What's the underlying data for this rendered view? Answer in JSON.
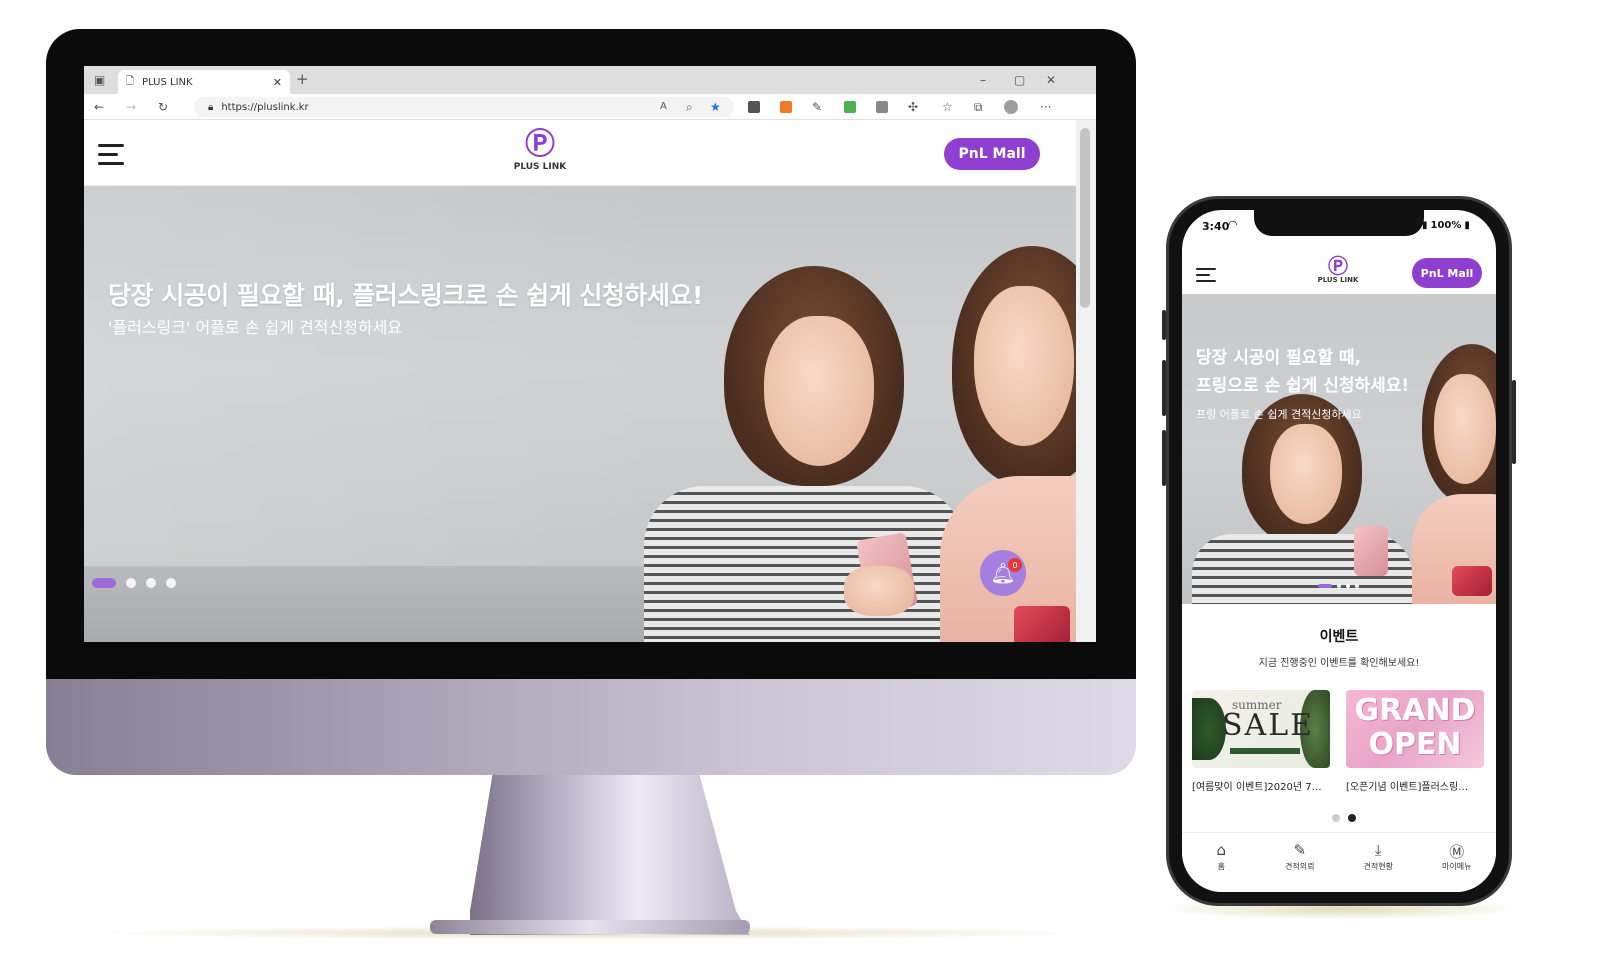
{
  "browser": {
    "tab_title": "PLUS LINK",
    "url": "https://pluslink.kr"
  },
  "site": {
    "logo_text": "PLUS LINK",
    "mall_button": "PnL Mall"
  },
  "desktop_hero": {
    "title": "당장 시공이 필요할 때, 플러스링크로 손 쉽게 신청하세요!",
    "subtitle": "'플러스링크' 어플로 손 쉽게 견적신청하세요",
    "notification_count": "0",
    "slide_count": 4,
    "active_slide": 1
  },
  "mobile": {
    "status_time": "3:40",
    "battery": "100%",
    "hero_title_line1": "당장 시공이 필요할 때,",
    "hero_title_line2": "프링으로 손 쉽게 신청하세요!",
    "hero_subtitle": "프링 어플로 손 쉽게 견적신청하세요",
    "events_title": "이벤트",
    "events_subtitle": "지금 진행중인 이벤트를 확인해보세요!",
    "events": [
      {
        "caption": "[여름맞이 이벤트]2020년 7…",
        "banner_small": "summer",
        "banner_big": "SALE"
      },
      {
        "caption": "[오픈기념 이벤트]플러스링…",
        "banner_big": "GRAND",
        "banner_big2": "OPEN"
      }
    ],
    "nav": [
      {
        "label": "홈",
        "icon": "home-icon"
      },
      {
        "label": "견적의뢰",
        "icon": "edit-icon"
      },
      {
        "label": "견적현황",
        "icon": "download-icon"
      },
      {
        "label": "마이메뉴",
        "icon": "my-menu-icon"
      }
    ]
  },
  "colors": {
    "brand_purple": "#8e3fd0",
    "bell_purple": "#a57fe0",
    "badge_red": "#e53935"
  }
}
